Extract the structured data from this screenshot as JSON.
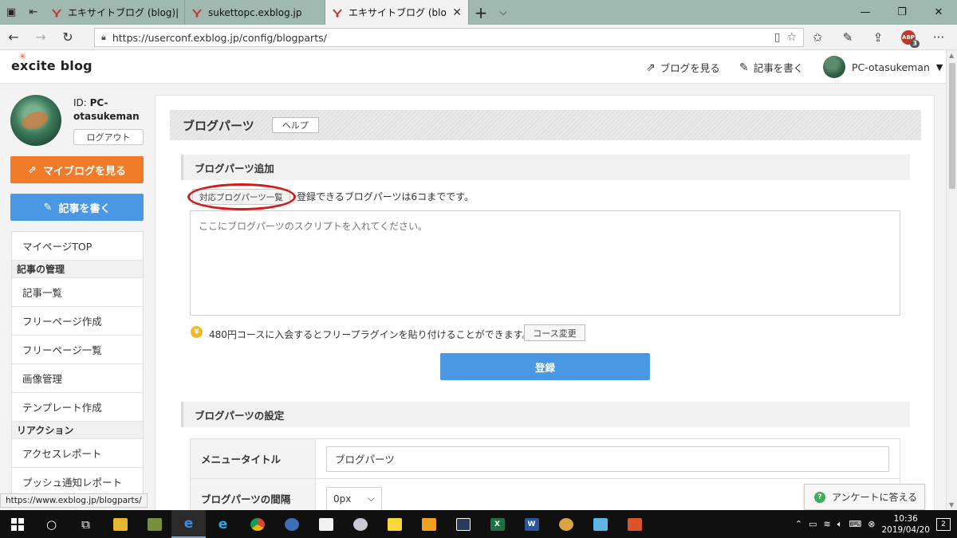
{
  "browser": {
    "tabs": [
      {
        "label": "エキサイトブログ (blog)|新規投",
        "active": false
      },
      {
        "label": "sukettopc.exblog.jp",
        "active": false
      },
      {
        "label": "エキサイトブログ (blog)|ブロ",
        "active": true
      }
    ],
    "url": "https://userconf.exblog.jp/config/blogparts/",
    "abp_label": "ABP",
    "abp_count": "3",
    "status_url": "https://www.exblog.jp/blogparts/"
  },
  "header": {
    "logo_text": "excite blog",
    "view_blog": "ブログを見る",
    "write_post": "記事を書く",
    "user_name": "PC-otasukeman"
  },
  "sidebar": {
    "id_prefix": "ID: ",
    "id_value": "PC-otasukeman",
    "logout": "ログアウト",
    "my_blog_button": "マイブログを見る",
    "write_button": "記事を書く",
    "menu": [
      {
        "type": "item",
        "label": "マイページTOP"
      },
      {
        "type": "header",
        "label": "記事の管理"
      },
      {
        "type": "item",
        "label": "記事一覧"
      },
      {
        "type": "item",
        "label": "フリーページ作成"
      },
      {
        "type": "item",
        "label": "フリーページ一覧"
      },
      {
        "type": "item",
        "label": "画像管理"
      },
      {
        "type": "item",
        "label": "テンプレート作成"
      },
      {
        "type": "header",
        "label": "リアクション"
      },
      {
        "type": "item",
        "label": "アクセスレポート"
      },
      {
        "type": "item",
        "label": "プッシュ通知レポート"
      }
    ]
  },
  "main": {
    "page_title": "ブログパーツ",
    "help_button": "ヘルプ",
    "add_section": {
      "heading": "ブログパーツ追加",
      "parts_list_button": "対応ブログパーツ一覧",
      "limit_text": "登録できるブログパーツは6コまでです。",
      "script_placeholder": "ここにブログパーツのスクリプトを入れてください。",
      "coin_symbol": "¥",
      "course_text": "480円コースに入会するとフリープラグインを貼り付けることができます。",
      "course_button": "コース変更",
      "submit_button": "登録"
    },
    "settings_section": {
      "heading": "ブログパーツの設定",
      "menu_title_label": "メニュータイトル",
      "menu_title_value": "ブログパーツ",
      "spacing_label": "ブログパーツの間隔",
      "spacing_value": "0px"
    },
    "survey_button": "アンケートに答える"
  },
  "taskbar": {
    "time": "10:36",
    "date": "2019/04/20",
    "notification_count": "2",
    "apps": [
      "file-explorer",
      "photos",
      "edge",
      "internet-explorer",
      "chrome",
      "network",
      "store",
      "paint-3d",
      "sticky-notes",
      "app-orange",
      "app-dark",
      "excel",
      "word",
      "paint",
      "app-blue",
      "app-red"
    ]
  },
  "colors": {
    "orange_button": "#f07c2a",
    "blue_button": "#4a98e3",
    "annotation_ring": "#d11b1b"
  }
}
